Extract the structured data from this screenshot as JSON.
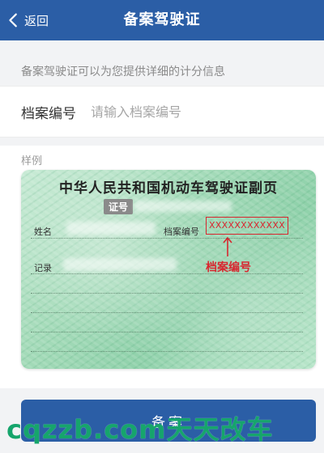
{
  "header": {
    "back_label": "返回",
    "title": "备案驾驶证"
  },
  "description": "备案驾驶证可以为您提供详细的计分信息",
  "form": {
    "label": "档案编号",
    "placeholder": "请输入档案编号",
    "value": ""
  },
  "sample": {
    "label": "样例",
    "card_title": "中华人民共和国机动车驾驶证副页",
    "zheng_tag": "证号",
    "name_label": "姓名",
    "dossier_label": "档案编号",
    "record_label": "记录",
    "dossier_number": "XXXXXXXXXXXX",
    "callout": "档案编号"
  },
  "submit_label": "备案",
  "watermark": "cqzzb.com天天改车",
  "colors": {
    "primary": "#2b5ea6",
    "callout_red": "#d8262f",
    "watermark_green": "#16a56c"
  }
}
